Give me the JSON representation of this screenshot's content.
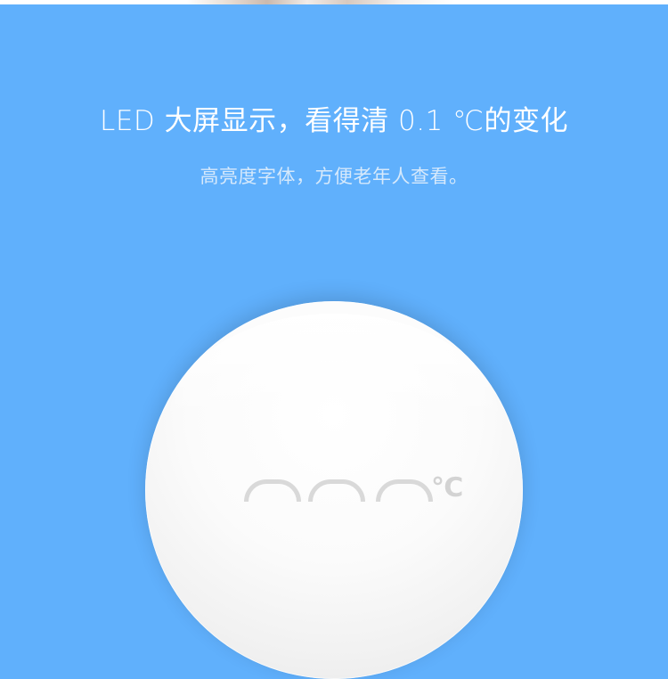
{
  "banner": {
    "headline": "LED 大屏显示，看得清 0.1 ℃的变化",
    "subline": "高亮度字体，方便老年人查看。"
  },
  "device": {
    "display_unit": "℃"
  },
  "colors": {
    "background": "#60b0fc",
    "text_primary": "#ffffff",
    "text_secondary": "#d6e9fb",
    "device_body": "#f7f7f7"
  }
}
